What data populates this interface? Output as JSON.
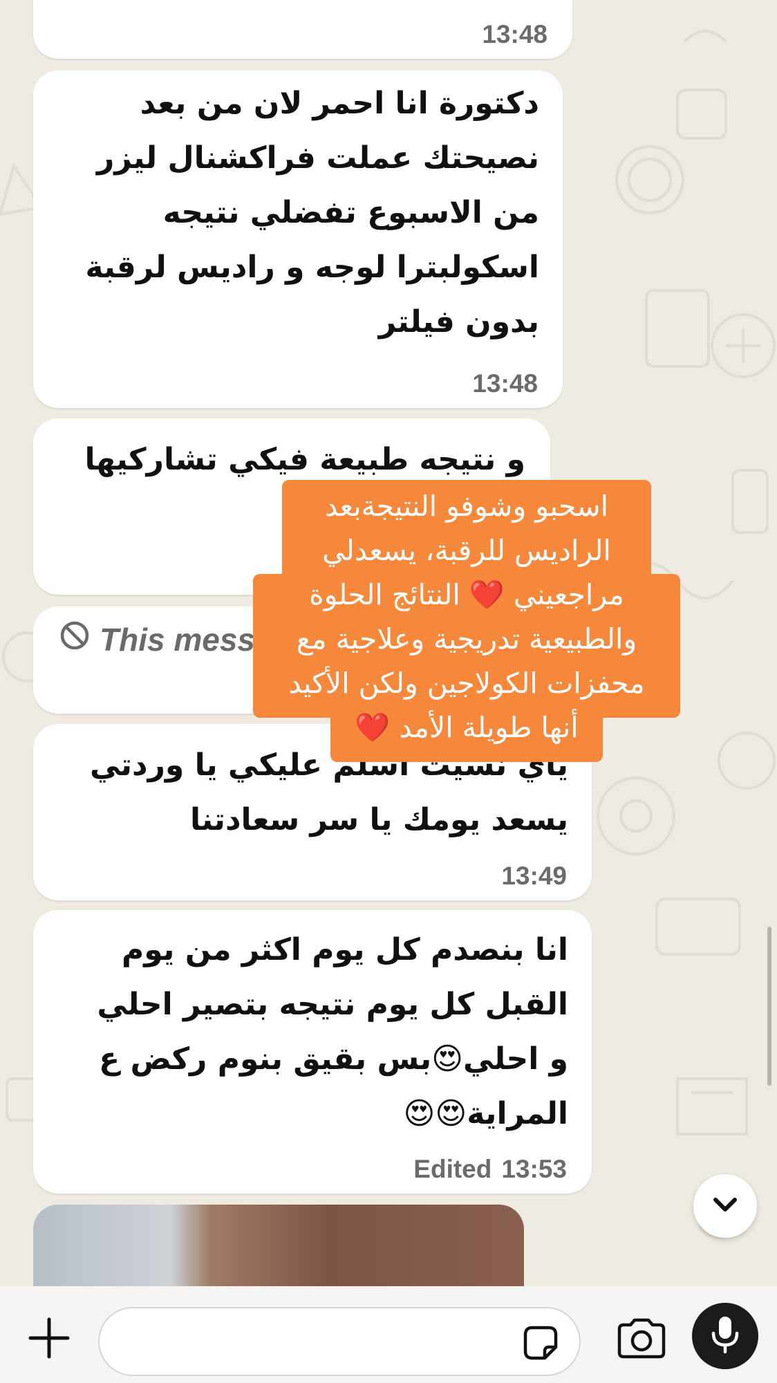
{
  "messages": [
    {
      "id": "m0",
      "lines": [],
      "time": "13:48"
    },
    {
      "id": "m1",
      "lines": [
        "دكتورة انا احمر لان من بعد",
        "نصيحتك عملت فراكشنال ليزر",
        "من الاسبوع تفضلي نتيجه",
        "اسكولبترا لوجه و راديس لرقبة",
        "بدون فيلتر"
      ],
      "time": "13:48"
    },
    {
      "id": "m2",
      "lines": [
        "و نتيجه طبيعة فيكي تشاركيها"
      ]
    },
    {
      "id": "m3",
      "deleted_text": "This mess"
    },
    {
      "id": "m4",
      "lines": [
        "ياي نسيت اسلم عليكي يا وردتي",
        "يسعد يومك يا سر سعادتنا"
      ],
      "time": "13:49"
    },
    {
      "id": "m5",
      "lines": [
        "انا بنصدم كل يوم اكثر من يوم",
        "القبل كل يوم نتيجه بتصير احلي",
        "و احلي😍بس بقيق بنوم ركض ع",
        "المراية😍😍"
      ],
      "edited": "Edited",
      "time": "13:53"
    }
  ],
  "overlay_caption": {
    "lines": [
      "اسحبو وشوفو النتيجةبعد",
      "الراديس للرقبة، يسعدلي",
      "مراجعيني ❤️ النتائج الحلوة",
      "والطبيعية تدريجية وعلاجية مع",
      "محفزات الكولاجين ولكن الأكيد",
      "أنها طويلة الأمد ❤️"
    ],
    "background": "#f5883a",
    "text_color": "#ffffff"
  },
  "icons": {
    "deleted": "prohibited-icon",
    "scroll_down": "chevron-down-icon",
    "attach": "plus-icon",
    "sticker": "sticker-icon",
    "camera": "camera-icon",
    "mic": "microphone-icon"
  },
  "composer": {
    "placeholder": ""
  },
  "colors": {
    "chat_background": "#efeae2",
    "bubble": "#ffffff",
    "meta_text": "#6b6b6b"
  }
}
